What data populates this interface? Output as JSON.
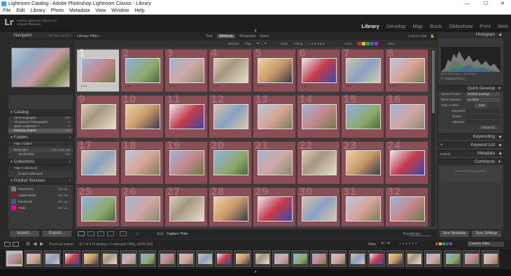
{
  "window": {
    "title": "Lightroom Catalog - Adobe Photoshop Lightroom Classic - Library"
  },
  "menu": [
    "File",
    "Edit",
    "Library",
    "Photo",
    "Metadata",
    "View",
    "Window",
    "Help"
  ],
  "identity": {
    "logo": "Lr",
    "line1": "Adobe Lightroom Classic CC",
    "line2": "Сергей Телешов"
  },
  "modules": [
    "Library",
    "Develop",
    "Map",
    "Book",
    "Slideshow",
    "Print",
    "Web"
  ],
  "left": {
    "navigator": {
      "title": "Navigator",
      "zoom": "FIT  FILL  1:1  3:1"
    },
    "catalog": {
      "title": "Catalog",
      "items": [
        {
          "label": "All Photographs",
          "count": "176"
        },
        {
          "label": "All Synced Photographs",
          "count": "0"
        },
        {
          "label": "Quick Collection +",
          "count": "0"
        },
        {
          "label": "Previous Import",
          "count": "176"
        }
      ]
    },
    "folders": {
      "title": "Folders",
      "filter": "Filter Folders",
      "drive": "DATA (E:)",
      "drive_info": "150 / 931 GB",
      "folder": "18.08.2018",
      "folder_count": "176"
    },
    "collections": {
      "title": "Collections",
      "filter": "Filter Collections",
      "smart": "Smart Collections"
    },
    "publish": {
      "title": "Publish Services",
      "items": [
        {
          "label": "Hard Drive",
          "action": "Set Up..."
        },
        {
          "label": "Adobe Stock",
          "action": "Set Up..."
        },
        {
          "label": "Facebook",
          "action": "Set Up..."
        },
        {
          "label": "Flickr",
          "action": "Set Up..."
        }
      ]
    },
    "import_label": "Import...",
    "export_label": "Export..."
  },
  "filter": {
    "title": "Library Filter :",
    "tabs": [
      "Text",
      "Attribute",
      "Metadata",
      "None"
    ],
    "preset": "Custom Filter",
    "attr": [
      "Attribute",
      "Flag",
      "Edits",
      "Rating",
      "Color",
      "Kind"
    ]
  },
  "grid": {
    "numbers": [
      "1",
      "2",
      "3",
      "4",
      "5",
      "6",
      "7",
      "8",
      "9",
      "10",
      "11",
      "12",
      "13",
      "14",
      "15",
      "16",
      "17",
      "18",
      "19",
      "20",
      "21",
      "22",
      "23",
      "24",
      "25",
      "26",
      "27",
      "28",
      "29",
      "30",
      "31",
      "32"
    ]
  },
  "toolbar": {
    "sort_label": "Sort:",
    "sort_value": "Capture Time",
    "thumbnails": "Thumbnails"
  },
  "right": {
    "histogram": {
      "title": "Histogram",
      "info": "ISO 100   21 mm   f / 4.0   1/250 s",
      "original": "Original Photo"
    },
    "quick": {
      "title": "Quick Develop",
      "saved_preset": "Saved Preset",
      "saved_value": "Default Settings",
      "wb": "White Balance",
      "wb_value": "As Shot",
      "tone": "Tone Control",
      "tone_value": "Auto",
      "exposure": "Exposure",
      "clarity": "Clarity",
      "vibrance": "Vibrance",
      "reset": "Reset All"
    },
    "keywording": "Keywording",
    "keywordlist": "Keyword List",
    "metadata": {
      "title": "Metadata",
      "preset": "Default"
    },
    "comments": {
      "title": "Comments",
      "note": "Comments not supported"
    },
    "sync_meta": "Sync Metadata",
    "sync_set": "Sync Settings"
  },
  "filmstrip": {
    "source": "Previous Import",
    "status": "117 of 176 photos / 1 selected / IMG_2020.CR2",
    "filter_label": "Filter :",
    "filter_value": "Custom Filter"
  }
}
